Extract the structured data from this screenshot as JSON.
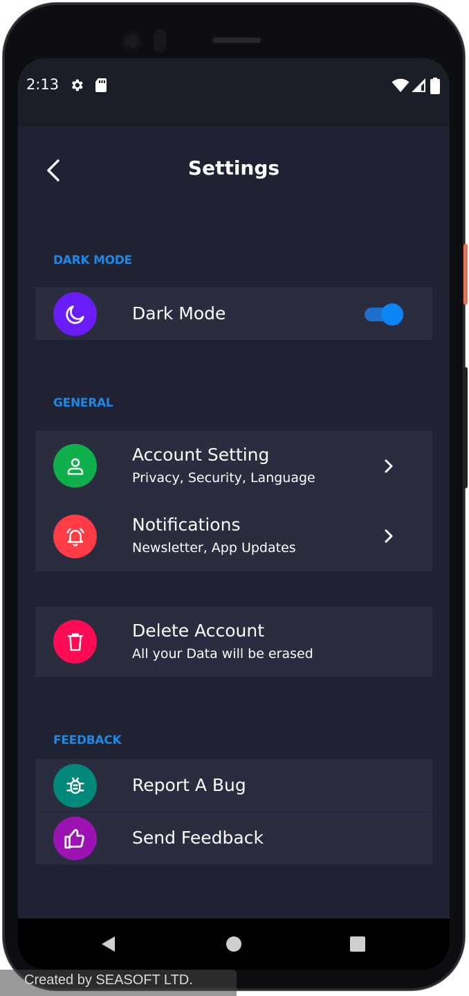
{
  "status_bar": {
    "time": "2:13",
    "left_icons": [
      "gear-icon",
      "sd-card-icon"
    ],
    "right_icons": [
      "wifi-icon",
      "signal-icon",
      "battery-icon"
    ]
  },
  "header": {
    "title": "Settings",
    "back_icon": "chevron-left-icon"
  },
  "sections": {
    "dark_mode": {
      "label": "DARK MODE",
      "item": {
        "title": "Dark Mode",
        "icon": "moon-icon",
        "icon_color": "#6a1cf6",
        "toggle_on": true
      }
    },
    "general": {
      "label": "GENERAL",
      "items": [
        {
          "title": "Account Setting",
          "subtitle": "Privacy, Security, Language",
          "icon": "user-icon",
          "icon_color": "#0fb04b"
        },
        {
          "title": "Notifications",
          "subtitle": "Newsletter, App Updates",
          "icon": "bell-icon",
          "icon_color": "#ff3b45"
        }
      ]
    },
    "danger": {
      "item": {
        "title": "Delete Account",
        "subtitle": "All your Data will be erased",
        "icon": "trash-icon",
        "icon_color": "#ff0a55"
      }
    },
    "feedback": {
      "label": "FEEDBACK",
      "items": [
        {
          "title": "Report A Bug",
          "icon": "bug-icon",
          "icon_color": "#00897b"
        },
        {
          "title": "Send Feedback",
          "icon": "thumbs-up-icon",
          "icon_color": "#9c12b3"
        }
      ]
    }
  },
  "nav_bar": {
    "buttons": [
      "back-triangle-icon",
      "home-circle-icon",
      "recents-square-icon"
    ]
  },
  "watermark": "Created by SEASOFT LTD.",
  "colors": {
    "background": "#1f2232",
    "card": "#2a2d40",
    "accent": "#1e88e5",
    "text": "#ffffff"
  }
}
